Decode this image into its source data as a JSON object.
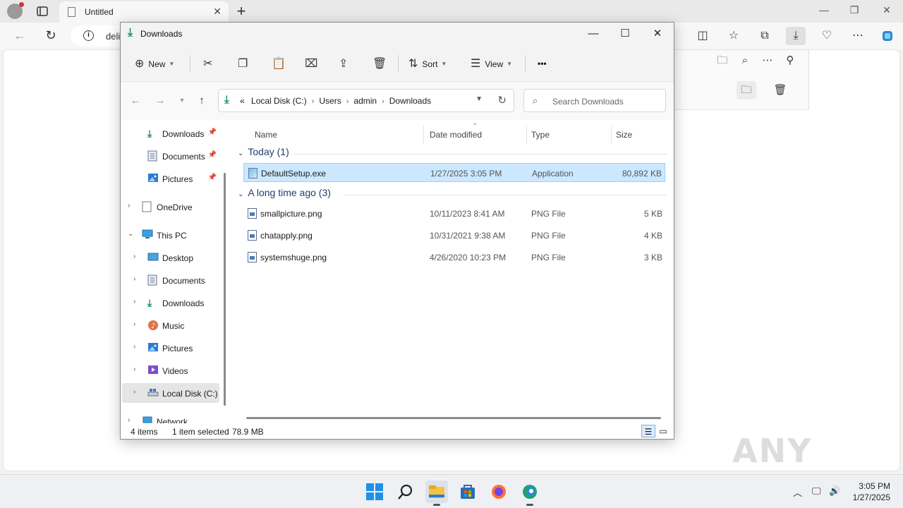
{
  "browser": {
    "tab_title": "Untitled",
    "url_partial": "deli",
    "new_tab": "+",
    "close_tab": "✕"
  },
  "explorer": {
    "title": "Downloads",
    "commands": {
      "new": "New",
      "sort": "Sort",
      "view": "View",
      "more": "•••"
    },
    "address": {
      "crumbs": [
        "Local Disk (C:)",
        "Users",
        "admin",
        "Downloads"
      ],
      "prefix": "«"
    },
    "search_placeholder": "Search Downloads",
    "sidebar": {
      "quick": [
        {
          "label": "Downloads",
          "icon": "download-icon"
        },
        {
          "label": "Documents",
          "icon": "documents-icon"
        },
        {
          "label": "Pictures",
          "icon": "pictures-icon"
        }
      ],
      "onedrive": "OneDrive",
      "thispc": "This PC",
      "pc_children": [
        {
          "label": "Desktop",
          "icon": "desktop-icon"
        },
        {
          "label": "Documents",
          "icon": "documents-icon"
        },
        {
          "label": "Downloads",
          "icon": "download-icon"
        },
        {
          "label": "Music",
          "icon": "music-icon"
        },
        {
          "label": "Pictures",
          "icon": "pictures-icon"
        },
        {
          "label": "Videos",
          "icon": "videos-icon"
        },
        {
          "label": "Local Disk (C:)",
          "icon": "drive-icon"
        }
      ],
      "network": "Network"
    },
    "columns": [
      "Name",
      "Date modified",
      "Type",
      "Size"
    ],
    "groups": [
      {
        "label": "Today (1)",
        "files": [
          {
            "name": "DefaultSetup.exe",
            "date": "1/27/2025 3:05 PM",
            "type": "Application",
            "size": "80,892 KB",
            "selected": true
          }
        ]
      },
      {
        "label": "A long time ago (3)",
        "files": [
          {
            "name": "smallpicture.png",
            "date": "10/11/2023 8:41 AM",
            "type": "PNG File",
            "size": "5 KB"
          },
          {
            "name": "chatapply.png",
            "date": "10/31/2021 9:38 AM",
            "type": "PNG File",
            "size": "4 KB"
          },
          {
            "name": "systemshuge.png",
            "date": "4/26/2020 10:23 PM",
            "type": "PNG File",
            "size": "3 KB"
          }
        ]
      }
    ],
    "status": {
      "count": "4 items",
      "selection": "1 item selected",
      "selection_size": "78.9 MB"
    }
  },
  "taskbar": {
    "time": "3:05 PM",
    "date": "1/27/2025"
  },
  "watermark": "ANY RUN",
  "colors": {
    "accent": "#0078d4",
    "selection": "#cce8ff",
    "download_green": "#1b8f5a",
    "group_header": "#1f3f6e"
  }
}
